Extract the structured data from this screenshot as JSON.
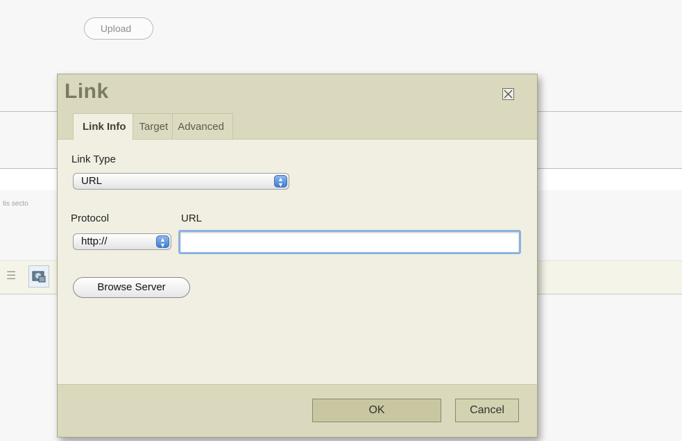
{
  "background": {
    "upload_label": "Upload",
    "truncated_text": "tis secto"
  },
  "dialog": {
    "title": "Link",
    "tabs": [
      {
        "label": "Link Info",
        "active": true
      },
      {
        "label": "Target",
        "active": false
      },
      {
        "label": "Advanced",
        "active": false
      }
    ],
    "link_type": {
      "label": "Link Type",
      "value": "URL"
    },
    "protocol": {
      "label": "Protocol",
      "value": "http://"
    },
    "url": {
      "label": "URL",
      "value": ""
    },
    "browse_label": "Browse Server",
    "ok_label": "OK",
    "cancel_label": "Cancel"
  },
  "icons": {
    "close": "close-icon",
    "select_arrows": "up-down-arrows-icon",
    "toolbar_image": "image-icon",
    "list": "list-icon"
  },
  "colors": {
    "dialog_header": "#dad9bd",
    "dialog_body": "#f0efe2",
    "ok_button": "#c9c7a1",
    "focus_ring": "#8cb2e0",
    "select_arrow": "#3b7fd5"
  }
}
